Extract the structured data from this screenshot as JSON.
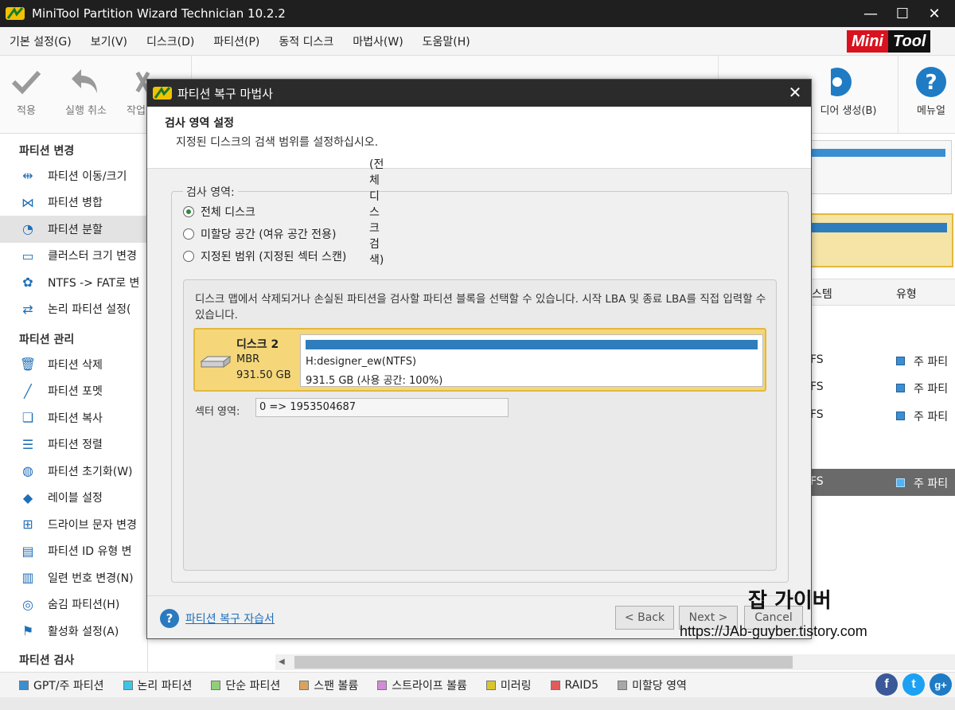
{
  "window": {
    "title": "MiniTool Partition Wizard Technician 10.2.2",
    "controls": [
      "—",
      "☐",
      "✕"
    ]
  },
  "menu": [
    "기본 설정(G)",
    "보기(V)",
    "디스크(D)",
    "파티션(P)",
    "동적 디스크",
    "마법사(W)",
    "도움말(H)"
  ],
  "brand": {
    "mini": "Mini",
    "tool": "Tool"
  },
  "toolbar": {
    "apply": "적용",
    "undo": "실행 취소",
    "discard": "작업",
    "media": "디어 생성(B)",
    "manual": "메뉴얼"
  },
  "sidebar": {
    "section_change": "파티션 변경",
    "change_items": [
      {
        "label": "파티션 이동/크기",
        "icon": "move-resize-icon"
      },
      {
        "label": "파티션 병합",
        "icon": "merge-icon"
      },
      {
        "label": "파티션 분할",
        "icon": "split-icon"
      },
      {
        "label": "클러스터 크기 변경",
        "icon": "cluster-icon"
      },
      {
        "label": "NTFS -> FAT로 변",
        "icon": "convert-icon"
      },
      {
        "label": "논리 파티션 설정(",
        "icon": "logical-icon"
      }
    ],
    "section_manage": "파티션 관리",
    "manage_items": [
      {
        "label": "파티션 삭제",
        "icon": "delete-icon"
      },
      {
        "label": "파티션 포멧",
        "icon": "format-icon"
      },
      {
        "label": "파티션 복사",
        "icon": "copy-icon"
      },
      {
        "label": "파티션 정렬",
        "icon": "align-icon"
      },
      {
        "label": "파티션 초기화(W)",
        "icon": "wipe-icon"
      },
      {
        "label": "레이블 설정",
        "icon": "label-icon"
      },
      {
        "label": "드라이브 문자 변경",
        "icon": "drive-letter-icon"
      },
      {
        "label": "파티션 ID 유형 변",
        "icon": "type-id-icon"
      },
      {
        "label": "일련 번호 변경(N)",
        "icon": "serial-icon"
      },
      {
        "label": "숨김 파티션(H)",
        "icon": "hide-icon"
      },
      {
        "label": "활성화 설정(A)",
        "icon": "flag-icon"
      }
    ],
    "section_check": "파티션 검사"
  },
  "right_panel": {
    "col_fs": "스템",
    "col_type": "유형",
    "rows": [
      {
        "fs": "FS",
        "type": "주 파티"
      },
      {
        "fs": "FS",
        "type": "주 파티"
      },
      {
        "fs": "FS",
        "type": "주 파티"
      },
      {
        "fs": "FS",
        "type": "주 파티"
      }
    ]
  },
  "dialog": {
    "title": "파티션 복구 마법사",
    "header_title": "검사 영역 설정",
    "header_subtitle": "지정된 디스크의 검색 범위를 설정하십시오.",
    "group_title": "검사 영역:",
    "options": [
      {
        "label": "전체 디스크",
        "desc": "(전체 디스크 검색)",
        "checked": true
      },
      {
        "label": "미할당 공간 (여유 공간 전용)",
        "desc": "",
        "checked": false
      },
      {
        "label": "지정된 범위 (지정된 섹터 스캔)",
        "desc": "",
        "checked": false
      }
    ],
    "description": "디스크 맵에서 삭제되거나 손실된 파티션을 검사할 파티션 블록을 선택할 수 있습니다. 시작 LBA 및 종료 LBA를 직접 입력할 수 있습니다.",
    "disk": {
      "name": "디스크 2",
      "style": "MBR",
      "size": "931.50 GB",
      "partition_label": "H:designer_ew(NTFS)",
      "partition_size": "931.5 GB (사용 공간: 100%)"
    },
    "sector_label": "섹터 영역:",
    "sector_value": "0 => 1953504687",
    "help_link": "파티션 복구 자습서",
    "back": "< Back",
    "next": "Next >",
    "cancel": "Cancel"
  },
  "legend": [
    {
      "label": "GPT/주 파티션",
      "color": "#3b8fd0"
    },
    {
      "label": "논리 파티션",
      "color": "#3fc4e8"
    },
    {
      "label": "단순 파티션",
      "color": "#8fcf7a"
    },
    {
      "label": "스팬 볼륨",
      "color": "#d8a45c"
    },
    {
      "label": "스트라이프 볼륨",
      "color": "#d48bd6"
    },
    {
      "label": "미러링",
      "color": "#d9c62c"
    },
    {
      "label": "RAID5",
      "color": "#e25a5a"
    },
    {
      "label": "미할당 영역",
      "color": "#a8a8a8"
    }
  ],
  "social": {
    "facebook": "f",
    "twitter": "t",
    "google": "g+"
  },
  "watermark": {
    "title": "잡 가이버",
    "url": "https://JAb-guyber.tistory.com"
  }
}
